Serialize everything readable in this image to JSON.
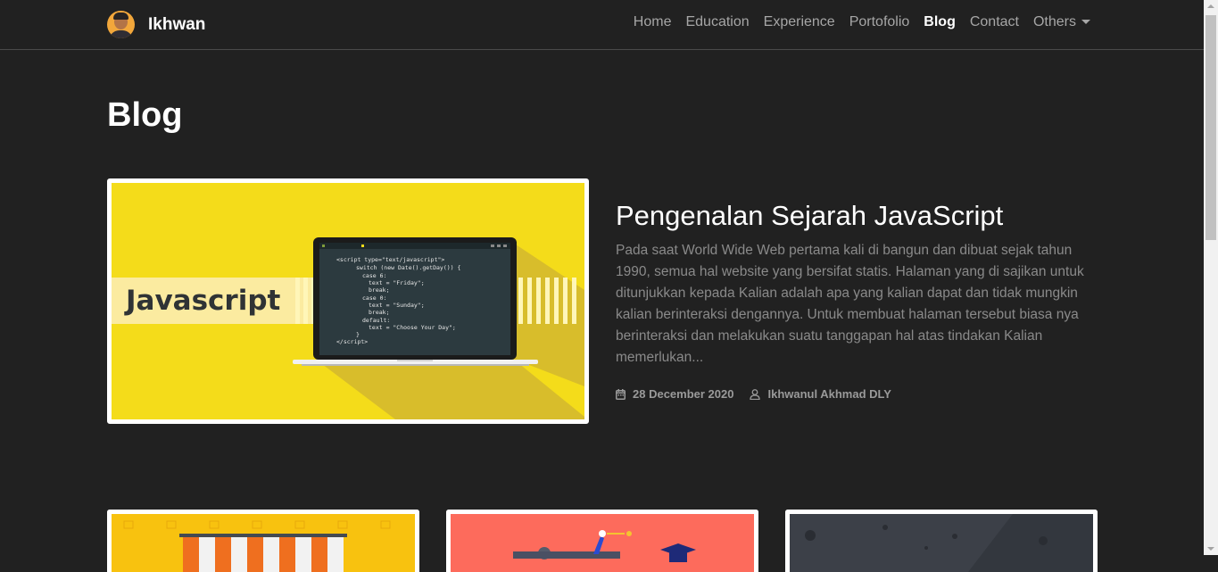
{
  "navbar": {
    "brand": "Ikhwan",
    "links": [
      {
        "label": "Home"
      },
      {
        "label": "Education"
      },
      {
        "label": "Experience"
      },
      {
        "label": "Portofolio"
      },
      {
        "label": "Blog",
        "active": true
      },
      {
        "label": "Contact"
      },
      {
        "label": "Others",
        "dropdown": true
      }
    ]
  },
  "page": {
    "title": "Blog"
  },
  "featured_post": {
    "image": {
      "label": "Javascript",
      "code_lines": [
        "<script type=\"text/javascript\">",
        "switch (new Date().getDay()) {",
        "case 6:",
        "text = \"Friday\";",
        "break;",
        "case 0:",
        "text = \"Sunday\";",
        "break;",
        "default:",
        "text = \"Choose Your Day\";",
        "}",
        "</script>"
      ]
    },
    "title": "Pengenalan Sejarah JavaScript",
    "excerpt": "Pada saat World Wide Web pertama kali di bangun dan dibuat sejak tahun 1990, semua hal website yang bersifat statis. Halaman yang di sajikan untuk ditunjukkan kepada Kalian adalah apa yang kalian dapat dan tidak mungkin kalian berinteraksi dengannya. Untuk membuat halaman tersebut biasa nya berinteraksi dan melakukan suatu tanggapan hal atas tindakan Kalian memerlukan...",
    "date": "28 December 2020",
    "author": "Ikhwanul Akhmad DLY"
  },
  "colors": {
    "background": "#212121",
    "nav_text": "#a6a6a6",
    "excerpt_text": "#8a8a8a",
    "js_yellow": "#f4dc1a"
  },
  "icons": {
    "calendar": "calendar-icon",
    "author": "user-icon",
    "dropdown": "caret-down-icon"
  }
}
